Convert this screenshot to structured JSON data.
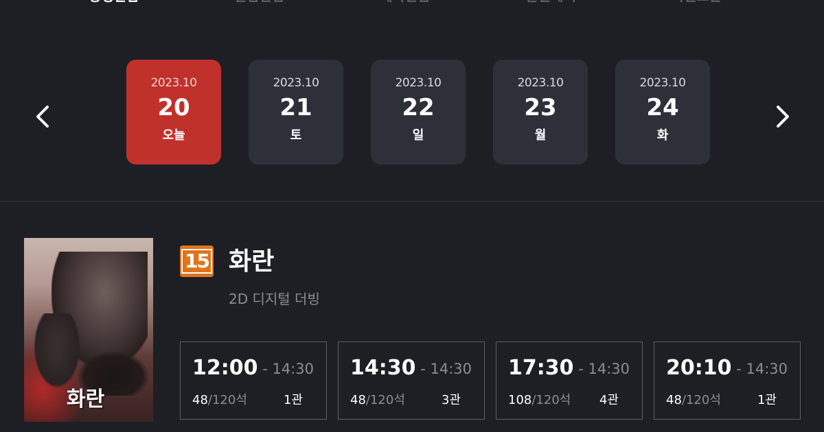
{
  "tabs": [
    "상영관람",
    "관람관람",
    "예약관람",
    "할인혜택",
    "이벤트관"
  ],
  "date_nav": {
    "prev_icon": "chevron-left-icon",
    "next_icon": "chevron-right-icon",
    "selected_index": 0,
    "dates": [
      {
        "ym": "2023.10",
        "day": "20",
        "weekday": "오늘"
      },
      {
        "ym": "2023.10",
        "day": "21",
        "weekday": "토"
      },
      {
        "ym": "2023.10",
        "day": "22",
        "weekday": "일"
      },
      {
        "ym": "2023.10",
        "day": "23",
        "weekday": "월"
      },
      {
        "ym": "2023.10",
        "day": "24",
        "weekday": "화"
      }
    ]
  },
  "movie": {
    "rating": "15",
    "title": "화란",
    "format": "2D 디지털 더빙",
    "poster_title": "화란",
    "showtimes": [
      {
        "start": "12:00",
        "end": "- 14:30",
        "available": "48",
        "total": "/120석",
        "hall": "1관"
      },
      {
        "start": "14:30",
        "end": "- 14:30",
        "available": "48",
        "total": "/120석",
        "hall": "3관"
      },
      {
        "start": "17:30",
        "end": "- 14:30",
        "available": "108",
        "total": "/120석",
        "hall": "4관"
      },
      {
        "start": "20:10",
        "end": "- 14:30",
        "available": "48",
        "total": "/120석",
        "hall": "1관"
      }
    ]
  },
  "colors": {
    "background": "#1e1f25",
    "selected_date": "#c0312c",
    "date_card": "#2d3039",
    "rating_badge": "#e0741d"
  }
}
